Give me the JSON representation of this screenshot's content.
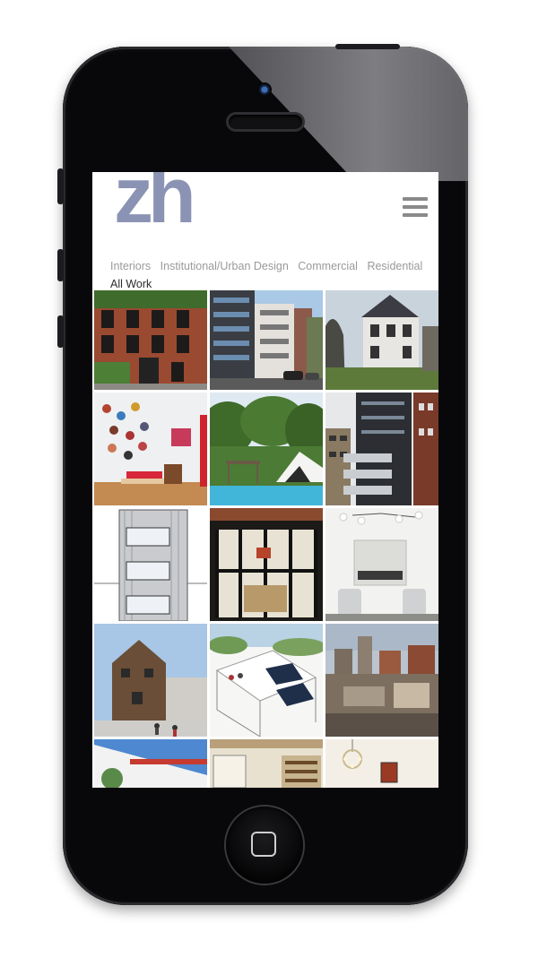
{
  "site": {
    "logo": "zh",
    "menu_icon": "hamburger-menu-icon"
  },
  "nav": {
    "items": [
      "Interiors",
      "Institutional/Urban Design",
      "Commercial",
      "Residential",
      "All Work"
    ],
    "active": "All Work"
  },
  "gallery": {
    "tiles": [
      {
        "subject": "brick-brownstone-facade"
      },
      {
        "subject": "modern-apartment-street"
      },
      {
        "subject": "victorian-house"
      },
      {
        "subject": "interior-hat-wall-bench"
      },
      {
        "subject": "pool-pavilion"
      },
      {
        "subject": "dark-apartment-tower"
      },
      {
        "subject": "elevation-drawing"
      },
      {
        "subject": "glass-house-night"
      },
      {
        "subject": "dining-room-chandelier"
      },
      {
        "subject": "wood-house-rendering"
      },
      {
        "subject": "rooftop-solar-rendering"
      },
      {
        "subject": "aerial-city-rooftops"
      },
      {
        "subject": "white-building-red-stripe"
      },
      {
        "subject": "library-interior"
      },
      {
        "subject": "room-chandelier-painting"
      }
    ]
  },
  "colors": {
    "logo": "#8b93b4",
    "nav_inactive": "#9a9a9a",
    "nav_active": "#2b2b2b"
  }
}
